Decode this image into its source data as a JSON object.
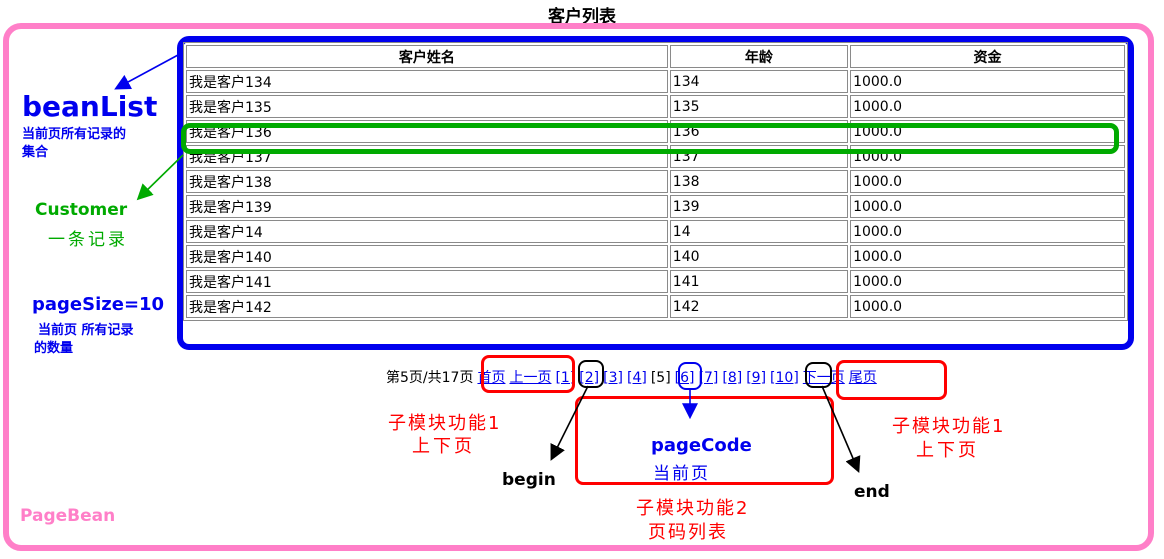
{
  "title": "客户列表",
  "table": {
    "headers": [
      "客户姓名",
      "年龄",
      "资金"
    ],
    "rows": [
      [
        "我是客户134",
        "134",
        "1000.0"
      ],
      [
        "我是客户135",
        "135",
        "1000.0"
      ],
      [
        "我是客户136",
        "136",
        "1000.0"
      ],
      [
        "我是客户137",
        "137",
        "1000.0"
      ],
      [
        "我是客户138",
        "138",
        "1000.0"
      ],
      [
        "我是客户139",
        "139",
        "1000.0"
      ],
      [
        "我是客户14",
        "14",
        "1000.0"
      ],
      [
        "我是客户140",
        "140",
        "1000.0"
      ],
      [
        "我是客户141",
        "141",
        "1000.0"
      ],
      [
        "我是客户142",
        "142",
        "1000.0"
      ]
    ]
  },
  "pager": {
    "status": "第5页/共17页",
    "first": "首页",
    "prev": "上一页",
    "pages": [
      "[1]",
      "[2]",
      "[3]",
      "[4]",
      "[5]",
      "[6]",
      "[7]",
      "[8]",
      "[9]",
      "[10]"
    ],
    "next": "下一页",
    "last": "尾页"
  },
  "annotations": {
    "beanlist": "beanList",
    "beanlist_desc_1": "当前页所有记录的",
    "beanlist_desc_2": "集合",
    "customer": "Customer",
    "customer_desc": "一条记录",
    "pagesize": "pageSize=10",
    "pagesize_desc_1": "当前页 所有记录",
    "pagesize_desc_2": "的数量",
    "module1_left_1": "子模块功能1",
    "module1_left_2": "上下页",
    "module1_right_1": "子模块功能1",
    "module1_right_2": "上下页",
    "pagecode": "pageCode",
    "pagecode_desc": "当前页",
    "begin": "begin",
    "end": "end",
    "module2_1": "子模块功能2",
    "module2_2": "页码列表",
    "pagebean": "PageBean"
  },
  "colors": {
    "pagebean_frame": "#ff7fc8",
    "beanlist_frame": "#0000ee",
    "customer_highlight": "#00aa00",
    "module_boxes": "#ff0000",
    "link": "#0000ee"
  }
}
